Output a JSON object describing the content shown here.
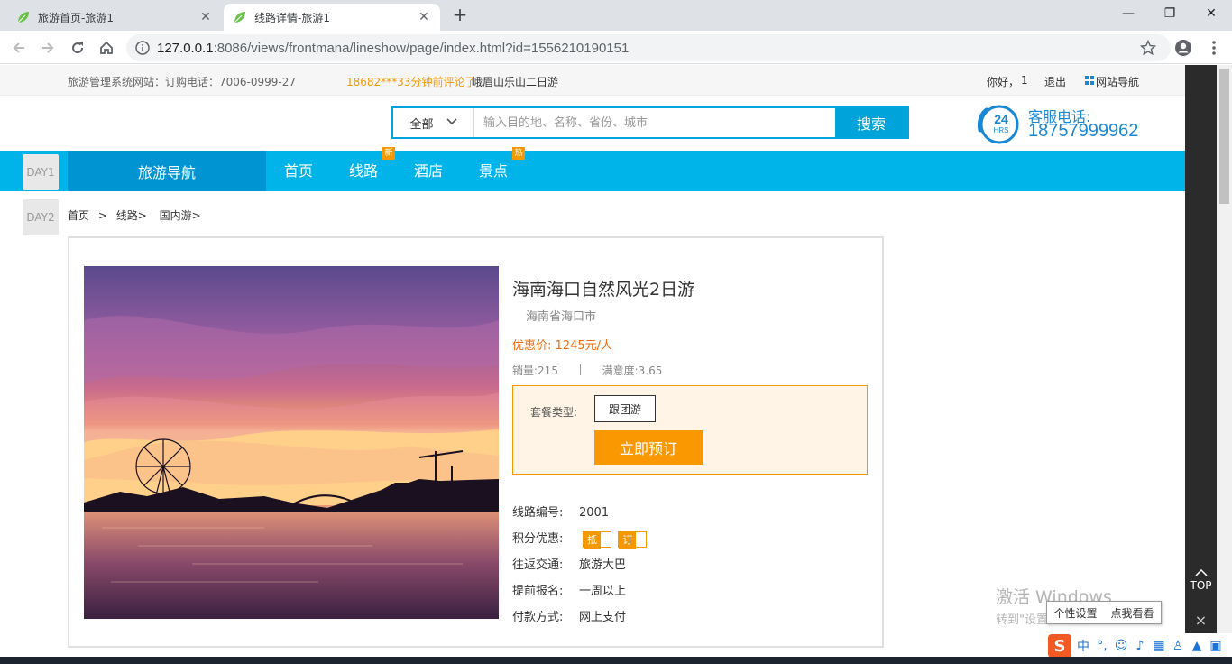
{
  "browser": {
    "tabs": [
      {
        "title": "旅游首页-旅游1",
        "active": false
      },
      {
        "title": "线路详情-旅游1",
        "active": true
      }
    ],
    "url_host": "127.0.0.1",
    "url_rest": ":8086/views/frontmana/lineshow/page/index.html?id=1556210190151",
    "icons": [
      "back-icon",
      "forward-icon",
      "reload-icon",
      "home-icon",
      "info-icon",
      "star-icon",
      "account-icon",
      "menu-icon"
    ]
  },
  "topbar": {
    "site_info": "旅游管理系统网站：订购电话：7006-0999-27",
    "ticker_user": "18682***33分钟前评论了",
    "ticker_item": "峨眉山乐山二日游",
    "greeting": "你好，",
    "username": "1",
    "logout": "退出",
    "site_nav": "网站导航"
  },
  "search": {
    "category": "全部",
    "placeholder": "输入目的地、名称、省份、城市",
    "button": "搜索"
  },
  "hotline": {
    "label": "客服电话:",
    "number": "18757999962",
    "badge_top": "24",
    "badge_bottom": "HRS"
  },
  "nav": {
    "guide": "旅游导航",
    "items": [
      {
        "label": "首页",
        "badge": ""
      },
      {
        "label": "线路",
        "badge": "新"
      },
      {
        "label": "酒店",
        "badge": ""
      },
      {
        "label": "景点",
        "badge": "热"
      }
    ]
  },
  "days": [
    "DAY1",
    "DAY2"
  ],
  "breadcrumb": [
    "首页",
    ">",
    "线路>",
    "国内游>"
  ],
  "line": {
    "title": "海南海口自然风光2日游",
    "location": "海南省海口市",
    "price_label": "优惠价:",
    "price": "1245元/人",
    "sales_label": "销量:",
    "sales": "215",
    "satisfaction_label": "满意度:",
    "satisfaction": "3.65",
    "package_label": "套餐类型:",
    "package": "跟团游",
    "book_button": "立即预订",
    "meta": [
      {
        "key": "线路编号:",
        "value": "2001"
      },
      {
        "key": "积分优惠:",
        "value": ""
      },
      {
        "key": "往返交通:",
        "value": "旅游大巴"
      },
      {
        "key": "提前报名:",
        "value": "一周以上"
      },
      {
        "key": "付款方式:",
        "value": "网上支付"
      }
    ],
    "points_pills": [
      "抵",
      "订"
    ]
  },
  "side": {
    "top": "TOP",
    "close": "×"
  },
  "watermark": {
    "line1": "激活 Windows",
    "line2": "转到\"设置\"以激活 Windows。"
  },
  "ime": {
    "tip_left": "个性设置",
    "tip_right": "点我看看",
    "logo": "S",
    "lang": "中"
  },
  "colors": {
    "brand": "#00b4ea",
    "brand_dark": "#0094d3",
    "accent": "#f99800",
    "price": "#f56a0b"
  }
}
